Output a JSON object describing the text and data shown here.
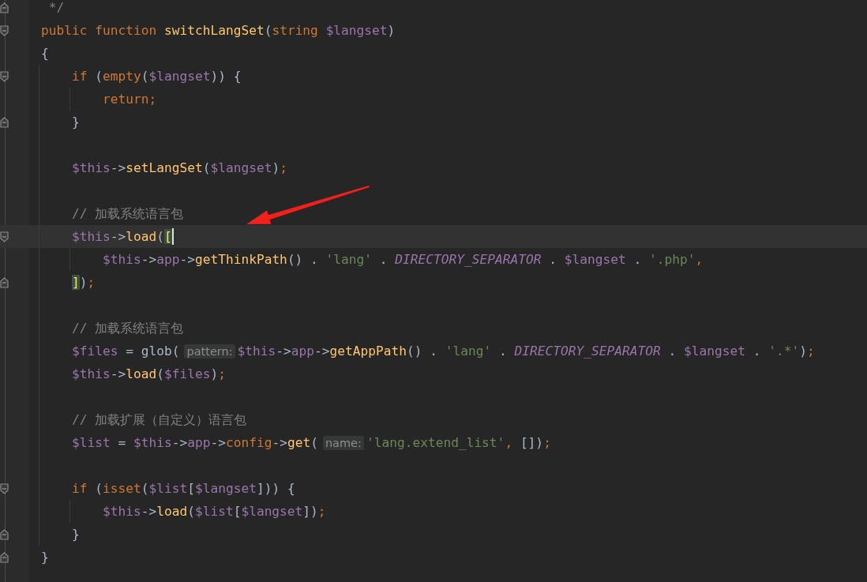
{
  "editor": {
    "lines": [
      {
        "kind": "code",
        "fold_start": false,
        "fold_end": true,
        "current": false,
        "tokens": [
          {
            "text": " */",
            "kind": "cmt"
          }
        ]
      },
      {
        "kind": "code",
        "fold_start": true,
        "fold_end": false,
        "current": false,
        "tokens": [
          {
            "text": "public function ",
            "kind": "kw"
          },
          {
            "text": "switchLangSet",
            "kind": "fn"
          },
          {
            "text": "(",
            "kind": "plain"
          },
          {
            "text": "string ",
            "kind": "kw"
          },
          {
            "text": "$langset",
            "kind": "var"
          },
          {
            "text": ")",
            "kind": "plain"
          }
        ]
      },
      {
        "kind": "code",
        "fold_start": false,
        "fold_end": false,
        "current": false,
        "tokens": [
          {
            "text": "{",
            "kind": "plain"
          }
        ],
        "children": [
          {
            "kind": "code",
            "fold_start": true,
            "fold_end": false,
            "current": false,
            "tokens": [
              {
                "text": "if ",
                "kind": "kw"
              },
              {
                "text": "(",
                "kind": "plain"
              },
              {
                "text": "empty",
                "kind": "kw"
              },
              {
                "text": "(",
                "kind": "plain"
              },
              {
                "text": "$langset",
                "kind": "var"
              },
              {
                "text": ")) {",
                "kind": "plain"
              }
            ],
            "children": [
              {
                "kind": "code",
                "fold_start": false,
                "fold_end": false,
                "current": false,
                "tokens": [
                  {
                    "text": "return;",
                    "kind": "kw"
                  }
                ]
              }
            ]
          },
          {
            "kind": "code",
            "fold_start": false,
            "fold_end": true,
            "current": false,
            "tokens": [
              {
                "text": "}",
                "kind": "plain"
              }
            ]
          },
          {
            "kind": "blank"
          },
          {
            "kind": "code",
            "fold_start": false,
            "fold_end": false,
            "current": false,
            "tokens": [
              {
                "text": "$this",
                "kind": "var"
              },
              {
                "text": "->",
                "kind": "plain"
              },
              {
                "text": "setLangSet",
                "kind": "fn"
              },
              {
                "text": "(",
                "kind": "plain"
              },
              {
                "text": "$langset",
                "kind": "var"
              },
              {
                "text": ")",
                "kind": "plain"
              },
              {
                "text": ";",
                "kind": "kw"
              }
            ]
          },
          {
            "kind": "blank"
          },
          {
            "kind": "code",
            "fold_start": false,
            "fold_end": false,
            "current": false,
            "tokens": [
              {
                "text": "// 加载系统语言包",
                "kind": "cmt"
              }
            ]
          },
          {
            "kind": "code",
            "fold_start": true,
            "fold_end": false,
            "current": true,
            "tokens": [
              {
                "text": "$this",
                "kind": "var"
              },
              {
                "text": "->",
                "kind": "plain"
              },
              {
                "text": "load",
                "kind": "fn"
              },
              {
                "text": "(",
                "kind": "plain"
              },
              {
                "text": "[",
                "kind": "brace",
                "cursor_after": true
              }
            ],
            "children": [
              {
                "kind": "code",
                "fold_start": false,
                "fold_end": false,
                "current": false,
                "tokens": [
                  {
                    "text": "$this",
                    "kind": "var"
                  },
                  {
                    "text": "->",
                    "kind": "plain"
                  },
                  {
                    "text": "app",
                    "kind": "var"
                  },
                  {
                    "text": "->",
                    "kind": "plain"
                  },
                  {
                    "text": "getThinkPath",
                    "kind": "fn"
                  },
                  {
                    "text": "() . ",
                    "kind": "plain"
                  },
                  {
                    "text": "'lang'",
                    "kind": "str"
                  },
                  {
                    "text": " . ",
                    "kind": "plain"
                  },
                  {
                    "text": "DIRECTORY_SEPARATOR",
                    "kind": "const"
                  },
                  {
                    "text": " . ",
                    "kind": "plain"
                  },
                  {
                    "text": "$langset",
                    "kind": "var"
                  },
                  {
                    "text": " . ",
                    "kind": "plain"
                  },
                  {
                    "text": "'.php'",
                    "kind": "str"
                  },
                  {
                    "text": ",",
                    "kind": "kw"
                  }
                ]
              }
            ]
          },
          {
            "kind": "code",
            "fold_start": false,
            "fold_end": true,
            "current": false,
            "tokens": [
              {
                "text": "]",
                "kind": "brace"
              },
              {
                "text": ")",
                "kind": "plain"
              },
              {
                "text": ";",
                "kind": "kw"
              }
            ]
          },
          {
            "kind": "blank"
          },
          {
            "kind": "code",
            "fold_start": false,
            "fold_end": false,
            "current": false,
            "tokens": [
              {
                "text": "// 加载系统语言包",
                "kind": "cmt"
              }
            ]
          },
          {
            "kind": "code",
            "fold_start": false,
            "fold_end": false,
            "current": false,
            "tokens": [
              {
                "text": "$files",
                "kind": "var"
              },
              {
                "text": " = glob(",
                "kind": "plain"
              },
              {
                "text": "pattern:",
                "kind": "hint"
              },
              {
                "text": "$this",
                "kind": "var"
              },
              {
                "text": "->",
                "kind": "plain"
              },
              {
                "text": "app",
                "kind": "var"
              },
              {
                "text": "->",
                "kind": "plain"
              },
              {
                "text": "getAppPath",
                "kind": "fn"
              },
              {
                "text": "() . ",
                "kind": "plain"
              },
              {
                "text": "'lang'",
                "kind": "str"
              },
              {
                "text": " . ",
                "kind": "plain"
              },
              {
                "text": "DIRECTORY_SEPARATOR",
                "kind": "const"
              },
              {
                "text": " . ",
                "kind": "plain"
              },
              {
                "text": "$langset",
                "kind": "var"
              },
              {
                "text": " . ",
                "kind": "plain"
              },
              {
                "text": "'.*'",
                "kind": "str"
              },
              {
                "text": ")",
                "kind": "plain"
              },
              {
                "text": ";",
                "kind": "kw"
              }
            ]
          },
          {
            "kind": "code",
            "fold_start": false,
            "fold_end": false,
            "current": false,
            "tokens": [
              {
                "text": "$this",
                "kind": "var"
              },
              {
                "text": "->",
                "kind": "plain"
              },
              {
                "text": "load",
                "kind": "fn"
              },
              {
                "text": "(",
                "kind": "plain"
              },
              {
                "text": "$files",
                "kind": "var"
              },
              {
                "text": ")",
                "kind": "plain"
              },
              {
                "text": ";",
                "kind": "kw"
              }
            ]
          },
          {
            "kind": "blank"
          },
          {
            "kind": "code",
            "fold_start": false,
            "fold_end": false,
            "current": false,
            "tokens": [
              {
                "text": "// 加载扩展（自定义）语言包",
                "kind": "cmt"
              }
            ]
          },
          {
            "kind": "code",
            "fold_start": false,
            "fold_end": false,
            "current": false,
            "tokens": [
              {
                "text": "$list",
                "kind": "var"
              },
              {
                "text": " = ",
                "kind": "plain"
              },
              {
                "text": "$this",
                "kind": "var"
              },
              {
                "text": "->",
                "kind": "plain"
              },
              {
                "text": "app",
                "kind": "var"
              },
              {
                "text": "->",
                "kind": "plain"
              },
              {
                "text": "config",
                "kind": "kw"
              },
              {
                "text": "->",
                "kind": "plain"
              },
              {
                "text": "get",
                "kind": "fn"
              },
              {
                "text": "(",
                "kind": "plain"
              },
              {
                "text": "name:",
                "kind": "hint"
              },
              {
                "text": "'lang.extend_list'",
                "kind": "str"
              },
              {
                "text": ", ",
                "kind": "kw"
              },
              {
                "text": "[])",
                "kind": "plain"
              },
              {
                "text": ";",
                "kind": "kw"
              }
            ]
          },
          {
            "kind": "blank"
          },
          {
            "kind": "code",
            "fold_start": true,
            "fold_end": false,
            "current": false,
            "tokens": [
              {
                "text": "if ",
                "kind": "kw"
              },
              {
                "text": "(",
                "kind": "plain"
              },
              {
                "text": "isset",
                "kind": "kw"
              },
              {
                "text": "(",
                "kind": "plain"
              },
              {
                "text": "$list",
                "kind": "var"
              },
              {
                "text": "[",
                "kind": "plain"
              },
              {
                "text": "$langset",
                "kind": "var"
              },
              {
                "text": "])) {",
                "kind": "plain"
              }
            ],
            "children": [
              {
                "kind": "code",
                "fold_start": false,
                "fold_end": false,
                "current": false,
                "tokens": [
                  {
                    "text": "$this",
                    "kind": "var"
                  },
                  {
                    "text": "->",
                    "kind": "plain"
                  },
                  {
                    "text": "load",
                    "kind": "fn"
                  },
                  {
                    "text": "(",
                    "kind": "plain"
                  },
                  {
                    "text": "$list",
                    "kind": "var"
                  },
                  {
                    "text": "[",
                    "kind": "plain"
                  },
                  {
                    "text": "$langset",
                    "kind": "var"
                  },
                  {
                    "text": "])",
                    "kind": "plain"
                  },
                  {
                    "text": ";",
                    "kind": "kw"
                  }
                ]
              }
            ]
          },
          {
            "kind": "code",
            "fold_start": false,
            "fold_end": true,
            "current": false,
            "tokens": [
              {
                "text": "}",
                "kind": "plain"
              }
            ]
          }
        ]
      },
      {
        "kind": "code",
        "fold_start": false,
        "fold_end": true,
        "current": false,
        "tokens": [
          {
            "text": "}",
            "kind": "plain"
          }
        ]
      },
      {
        "kind": "blank"
      }
    ]
  }
}
